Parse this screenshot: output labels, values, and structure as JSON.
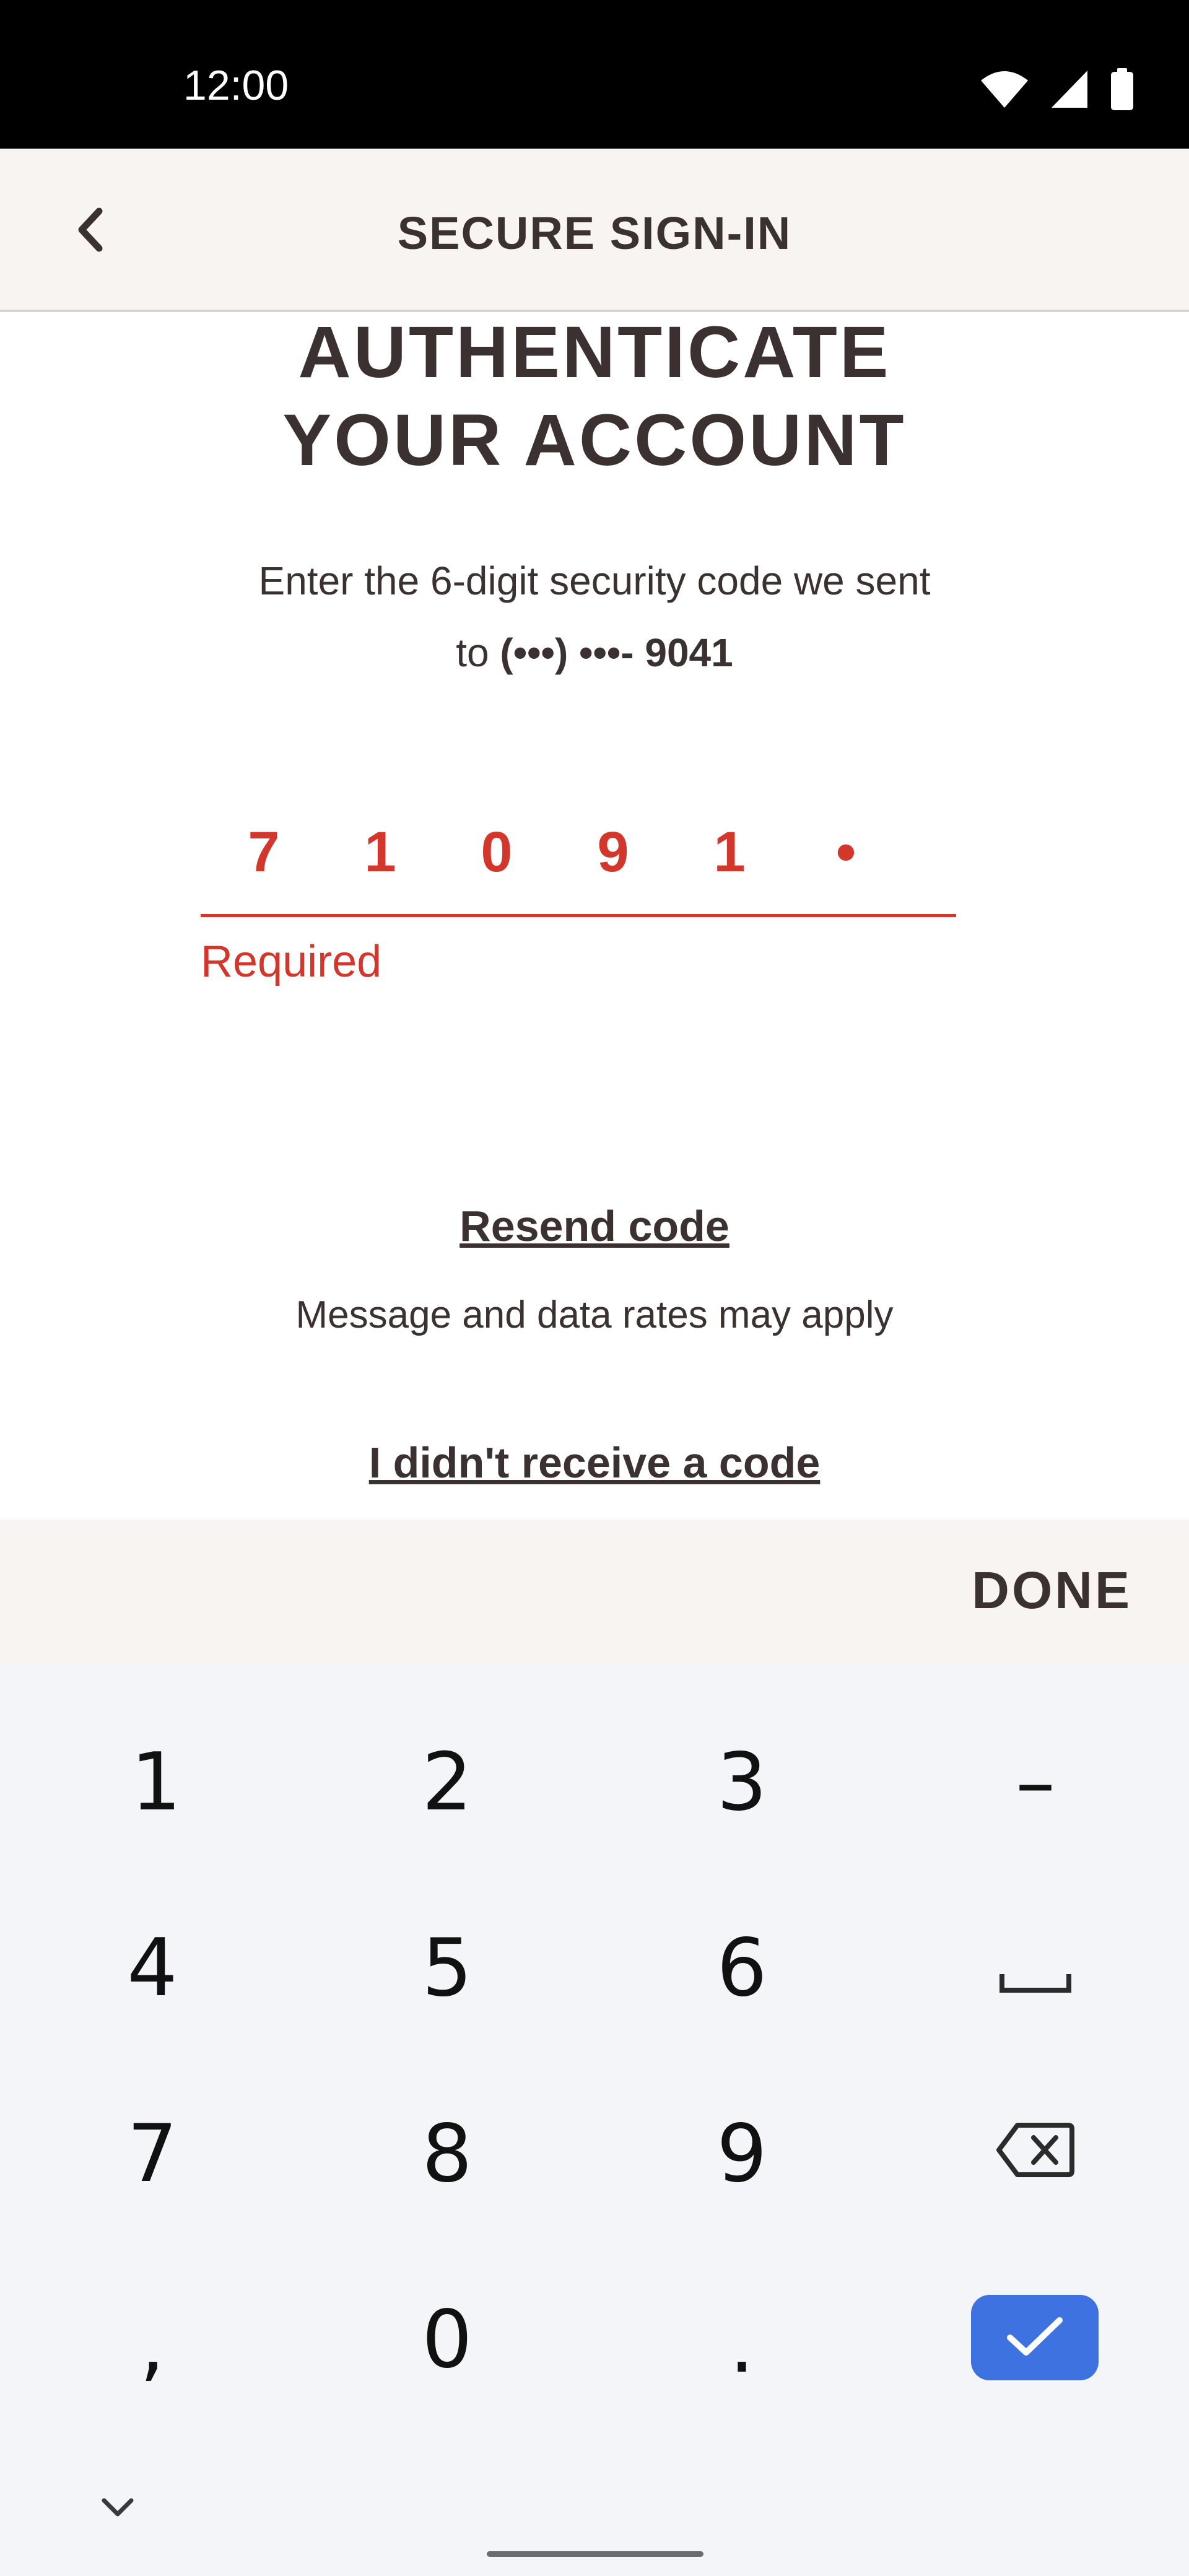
{
  "status_bar": {
    "time": "12:00",
    "icons": [
      "wifi-icon",
      "cellular-signal-icon",
      "battery-icon"
    ]
  },
  "header": {
    "back_icon": "chevron-left-icon",
    "title": "SECURE SIGN-IN"
  },
  "content": {
    "heading_line1": "AUTHENTICATE",
    "heading_line2": "YOUR ACCOUNT",
    "instruction_line1": "Enter the 6-digit security code we sent",
    "instruction_prefix": "to ",
    "phone": "(•••) •••- 9041",
    "code_input": {
      "digits": [
        "7",
        "1",
        "0",
        "9",
        "1",
        "•"
      ],
      "error": "Required"
    },
    "resend_link": "Resend code",
    "rates_note": "Message and data rates may apply",
    "no_code_link": "I didn't receive a code"
  },
  "keyboard_accessory": {
    "done_label": "DONE"
  },
  "keyboard": {
    "rows": [
      [
        "1",
        "2",
        "3",
        "–"
      ],
      [
        "4",
        "5",
        "6",
        "space-icon"
      ],
      [
        "7",
        "8",
        "9",
        "backspace-icon"
      ],
      [
        ",",
        "0",
        ".",
        "check-icon"
      ]
    ],
    "collapse_icon": "chevron-down-icon"
  },
  "colors": {
    "accent_error": "#d3372b",
    "text_dark": "#3a3130",
    "header_bg": "#f8f4f1",
    "keyboard_bg": "#f4f5f9",
    "enter_key": "#3d72e0"
  }
}
